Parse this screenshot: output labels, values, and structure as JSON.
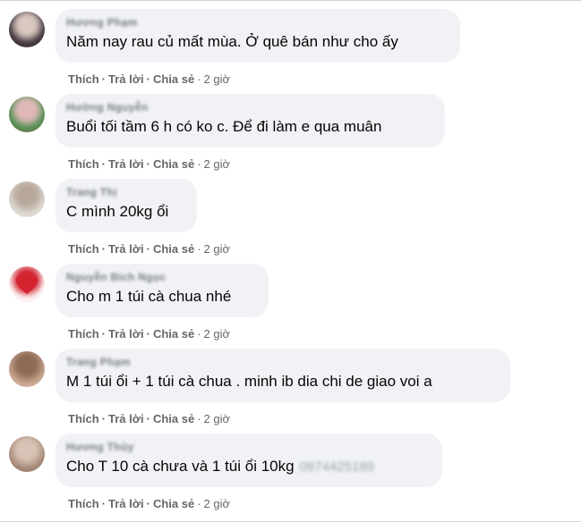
{
  "comments": [
    {
      "author": "Hương Phạm",
      "text": "Năm nay rau củ mất mùa. Ở quê bán như cho ấy",
      "phone": "",
      "actions": {
        "like": "Thích",
        "reply": "Trả lời",
        "share": "Chia sẻ",
        "time": "2 giờ"
      },
      "avatar_colors": [
        "#3a3038",
        "#d9c7c0",
        "#6b5a58"
      ]
    },
    {
      "author": "Hường Nguyễn",
      "text": "Buổi tối tầm 6 h có ko c. Để đi làm e qua muân",
      "phone": "",
      "actions": {
        "like": "Thích",
        "reply": "Trả lời",
        "share": "Chia sẻ",
        "time": "2 giờ"
      },
      "avatar_colors": [
        "#4a8f4e",
        "#e0b8b8",
        "#c94a5a"
      ]
    },
    {
      "author": "Trang Thị",
      "text": "C mình 20kg ổi",
      "phone": "",
      "actions": {
        "like": "Thích",
        "reply": "Trả lời",
        "share": "Chia sẻ",
        "time": "2 giờ"
      },
      "avatar_colors": [
        "#dcd7d0",
        "#b7a89a",
        "#efece6"
      ]
    },
    {
      "author": "Nguyễn Bích Ngọc",
      "text": "Cho m 1 túi cà chua nhé",
      "phone": "",
      "actions": {
        "like": "Thích",
        "reply": "Trả lời",
        "share": "Chia sẻ",
        "time": "2 giờ"
      },
      "avatar_colors": [
        "#ffffff",
        "#d2232f",
        "#f4c0c4"
      ]
    },
    {
      "author": "Trang Phạm",
      "text": "M 1 túi ổi + 1 túi cà chua . minh ib dia chi de giao voi a",
      "phone": "",
      "actions": {
        "like": "Thích",
        "reply": "Trả lời",
        "share": "Chia sẻ",
        "time": "2 giờ"
      },
      "avatar_colors": [
        "#c9a58f",
        "#8c6a55",
        "#e9d8ca"
      ]
    },
    {
      "author": "Hương Thủy",
      "text": "Cho T 10 cà chưa và 1 túi ổi 10kg",
      "phone": "0974425189",
      "actions": {
        "like": "Thích",
        "reply": "Trả lời",
        "share": "Chia sẻ",
        "time": "2 giờ"
      },
      "avatar_colors": [
        "#a88a78",
        "#d8c4b6",
        "#6e5548"
      ]
    }
  ]
}
